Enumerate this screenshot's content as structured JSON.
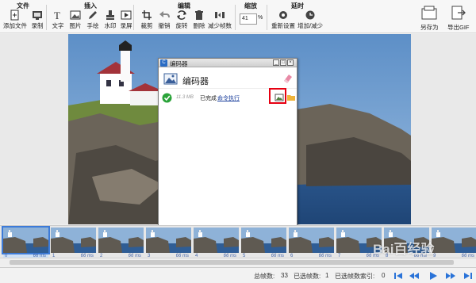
{
  "toolbar": {
    "groups": {
      "file": "文件",
      "insert": "插入",
      "edit": "编辑",
      "zoom": "缩放",
      "delay": "延时"
    },
    "buttons": {
      "add_file": "添加文件",
      "record": "录制",
      "text": "文字",
      "image": "图片",
      "draw": "手绘",
      "watermark": "水印",
      "screen": "录屏",
      "crop": "裁剪",
      "undo": "撤销",
      "rotate": "旋转",
      "delete": "删除",
      "reduce_frames": "减少帧数",
      "reset": "重新设置",
      "increase_decrease": "增加/减少",
      "save_as": "另存为",
      "export_gif": "导出GIF"
    },
    "zoom_value": "41",
    "zoom_unit": "%"
  },
  "dialog": {
    "window_title": "编码器",
    "heading": "编码器",
    "item": {
      "size": "11.3 MB",
      "status": "已完成",
      "link": "命令执行"
    }
  },
  "filmstrip": {
    "frames": [
      {
        "index": "0",
        "delay": "66 ms"
      },
      {
        "index": "1",
        "delay": "66 ms"
      },
      {
        "index": "2",
        "delay": "66 ms"
      },
      {
        "index": "3",
        "delay": "66 ms"
      },
      {
        "index": "4",
        "delay": "66 ms"
      },
      {
        "index": "5",
        "delay": "66 ms"
      },
      {
        "index": "6",
        "delay": "66 ms"
      },
      {
        "index": "7",
        "delay": "66 ms"
      },
      {
        "index": "8",
        "delay": "66 ms"
      },
      {
        "index": "9",
        "delay": "66 ms"
      }
    ]
  },
  "status": {
    "total_frames_label": "总帧数:",
    "total_frames": "33",
    "selected_frames_label": "已选帧数:",
    "selected_frames": "1",
    "selected_index_label": "已选帧数索引:",
    "selected_index": "0"
  },
  "watermark": "Bai百经验",
  "colors": {
    "accent_blue": "#3d7bd8",
    "link": "#1b3f9c",
    "highlight_red": "#e60012",
    "success_green": "#2aa339"
  }
}
